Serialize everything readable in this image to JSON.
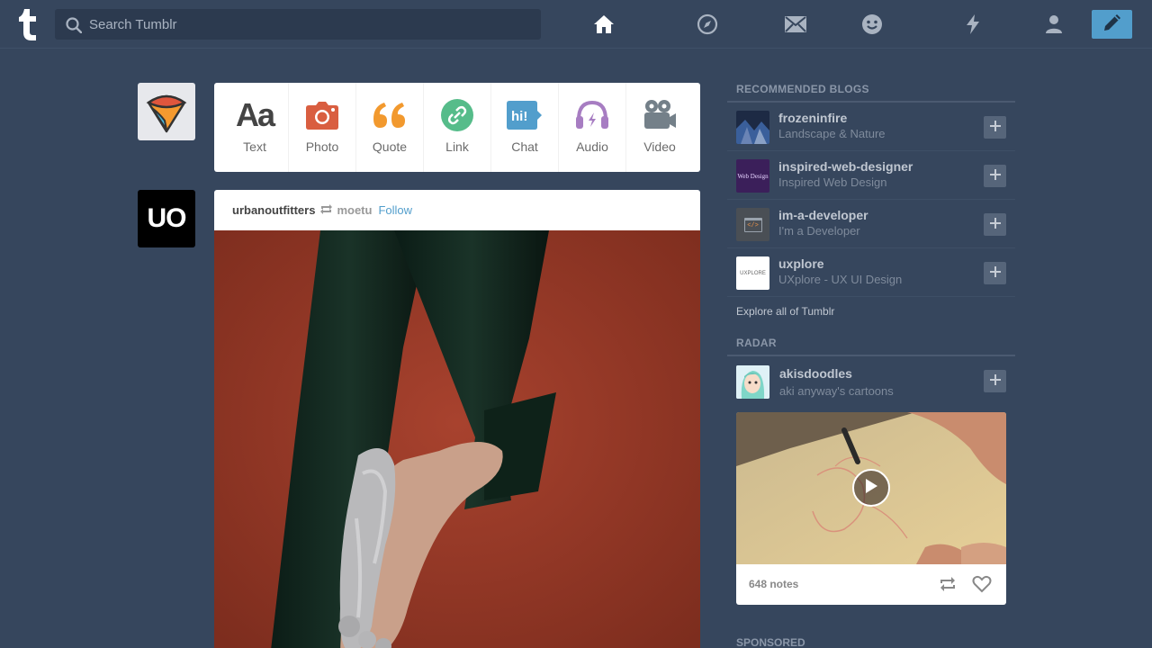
{
  "search": {
    "placeholder": "Search Tumblr"
  },
  "nav": {
    "icons": [
      "home-icon",
      "explore-icon",
      "inbox-icon",
      "messaging-icon",
      "activity-icon",
      "account-icon",
      "compose-icon"
    ]
  },
  "colors": {
    "background": "#36465d",
    "accent": "#529ecc",
    "white": "#ffffff"
  },
  "post_types": [
    {
      "label": "Text",
      "icon": "text-icon",
      "color": "#444444"
    },
    {
      "label": "Photo",
      "icon": "camera-icon",
      "color": "#d95e40"
    },
    {
      "label": "Quote",
      "icon": "quote-icon",
      "color": "#f2992e"
    },
    {
      "label": "Link",
      "icon": "link-icon",
      "color": "#56bc8a"
    },
    {
      "label": "Chat",
      "icon": "chat-icon",
      "color": "#529ecc"
    },
    {
      "label": "Audio",
      "icon": "headphones-icon",
      "color": "#a77dc2"
    },
    {
      "label": "Video",
      "icon": "video-camera-icon",
      "color": "#748089"
    }
  ],
  "post": {
    "avatar_text": "UO",
    "author": "urbanoutfitters",
    "source": "moetu",
    "follow_label": "Follow"
  },
  "sidebar": {
    "recommended_title": "RECOMMENDED BLOGS",
    "blogs": [
      {
        "name": "frozeninfire",
        "desc": "Landscape & Nature"
      },
      {
        "name": "inspired-web-designer",
        "desc": "Inspired Web Design",
        "thumb_text": "Web Design"
      },
      {
        "name": "im-a-developer",
        "desc": "I'm a Developer",
        "thumb_text": "</>"
      },
      {
        "name": "uxplore",
        "desc": "UXplore - UX UI Design",
        "thumb_text": "UXPLORE"
      }
    ],
    "explore_label": "Explore all of Tumblr",
    "radar_title": "RADAR",
    "radar": {
      "name": "akisdoodles",
      "desc": "aki anyway's cartoons",
      "notes": "648 notes"
    },
    "sponsored_title": "SPONSORED"
  }
}
